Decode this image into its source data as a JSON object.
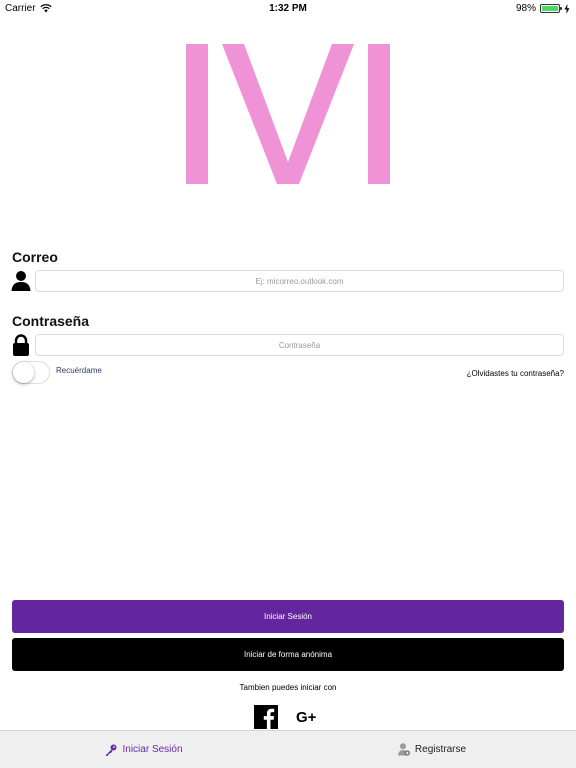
{
  "status_bar": {
    "carrier": "Carrier",
    "time": "1:32 PM",
    "battery_level": "98%",
    "battery_fraction": 0.98,
    "icons": [
      "wifi-icon",
      "battery-icon",
      "charging-icon"
    ]
  },
  "logo": {
    "color": "#f093d6"
  },
  "form": {
    "email_label": "Correo",
    "email_placeholder": "Ej: micorreo.outlook.com",
    "email_value": "",
    "password_label": "Contraseña",
    "password_placeholder": "Contraseña",
    "password_value": "",
    "remember_label": "Recuérdame",
    "remember_on": false,
    "forgot_link": "¿Olvidastes tu contraseña?"
  },
  "actions": {
    "login_label": "Iniciar Sesión",
    "anonymous_label": "Iniciar de forma anónima",
    "also_text": "Tambien puedes iniciar con",
    "social_icons": [
      "facebook-icon",
      "google-plus-icon"
    ],
    "google_plus_glyph": "G+"
  },
  "tabs": [
    {
      "label": "Iniciar Sesión",
      "icon": "key-icon",
      "active": true
    },
    {
      "label": "Registrarse",
      "icon": "user-add-icon",
      "active": false
    }
  ],
  "colors": {
    "accent": "#63269e",
    "tab_active": "#6a2aa8",
    "logo": "#f093d6",
    "anonymous_button": "#000000"
  }
}
